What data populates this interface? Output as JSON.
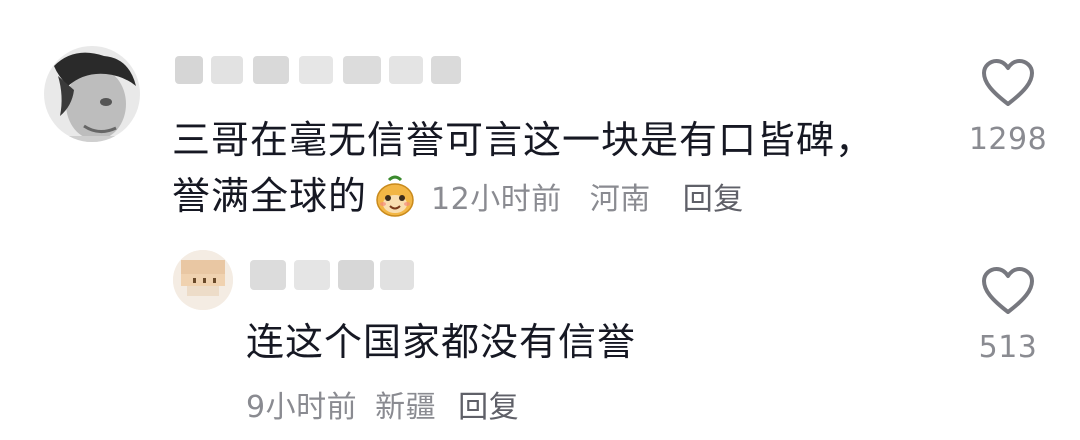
{
  "comments": [
    {
      "text_line1": "三哥在毫无信誉可言这一块是有口皆碑，",
      "text_line2": "誉满全球的",
      "emoji": "happy-bean-emoji",
      "time": "12小时前",
      "location": "河南",
      "reply_label": "回复",
      "likes": "1298"
    },
    {
      "text": "连这个国家都没有信誉",
      "time": "9小时前",
      "location": "新疆",
      "reply_label": "回复",
      "likes": "513"
    }
  ],
  "icons": {
    "like": "heart-outline-icon"
  },
  "colors": {
    "text_primary": "#161823",
    "text_secondary": "#8a8b91",
    "icon_stroke": "#77787f"
  }
}
